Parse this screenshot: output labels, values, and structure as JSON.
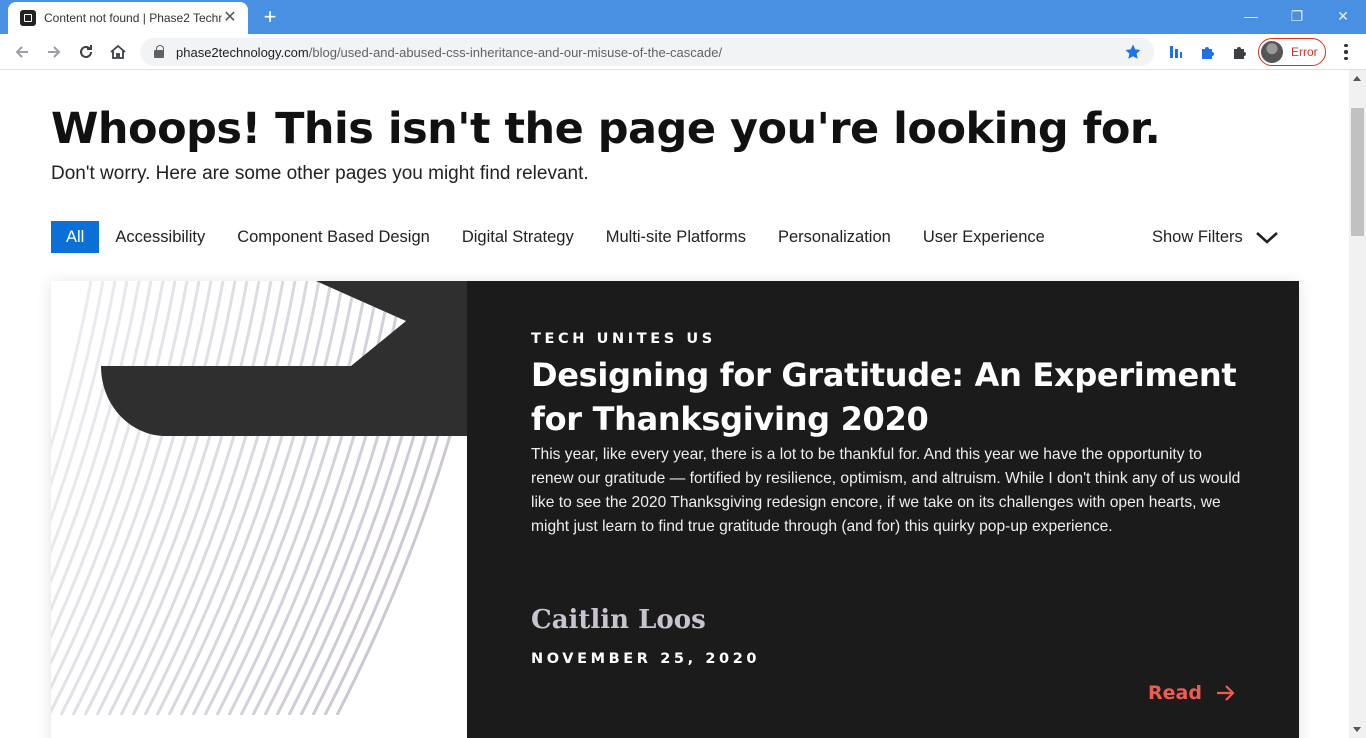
{
  "browser": {
    "tab_title": "Content not found | Phase2 Techn",
    "tab_close": "✕",
    "new_tab": "+",
    "url_host": "phase2technology.com",
    "url_path": "/blog/used-and-abused-css-inheritance-and-our-misuse-of-the-cascade/",
    "profile_status": "Error",
    "window_controls": {
      "minimize": "—",
      "restore": "❐",
      "close": "✕"
    }
  },
  "page": {
    "headline": "Whoops! This isn't the page you're looking for.",
    "subline": "Don't worry. Here are some other pages you might find relevant.",
    "filters": [
      {
        "label": "All",
        "active": true
      },
      {
        "label": "Accessibility",
        "active": false
      },
      {
        "label": "Component Based Design",
        "active": false
      },
      {
        "label": "Digital Strategy",
        "active": false
      },
      {
        "label": "Multi-site Platforms",
        "active": false
      },
      {
        "label": "Personalization",
        "active": false
      },
      {
        "label": "User Experience",
        "active": false
      }
    ],
    "show_filters": "Show Filters",
    "card": {
      "eyebrow": "TECH UNITES US",
      "title": "Designing for Gratitude: An Experiment for Thanksgiving 2020",
      "excerpt": "This year, like every year, there is a lot to be thankful for. And this year we have the opportunity to renew our gratitude — fortified by resilience, optimism, and altruism. While I don't think any of us would like to see the 2020 Thanksgiving redesign encore, if we take on its challenges with open hearts, we might just learn to find true gratitude through (and for) this quirky pop-up experience.",
      "author": "Caitlin Loos",
      "date": "NOVEMBER 25, 2020",
      "read_label": "Read"
    }
  },
  "colors": {
    "chrome_blue": "#4a90e2",
    "filter_active": "#0a6fd6",
    "card_dark": "#1c1b1c",
    "read_accent": "#f05a4f",
    "error_red": "#d93025"
  }
}
